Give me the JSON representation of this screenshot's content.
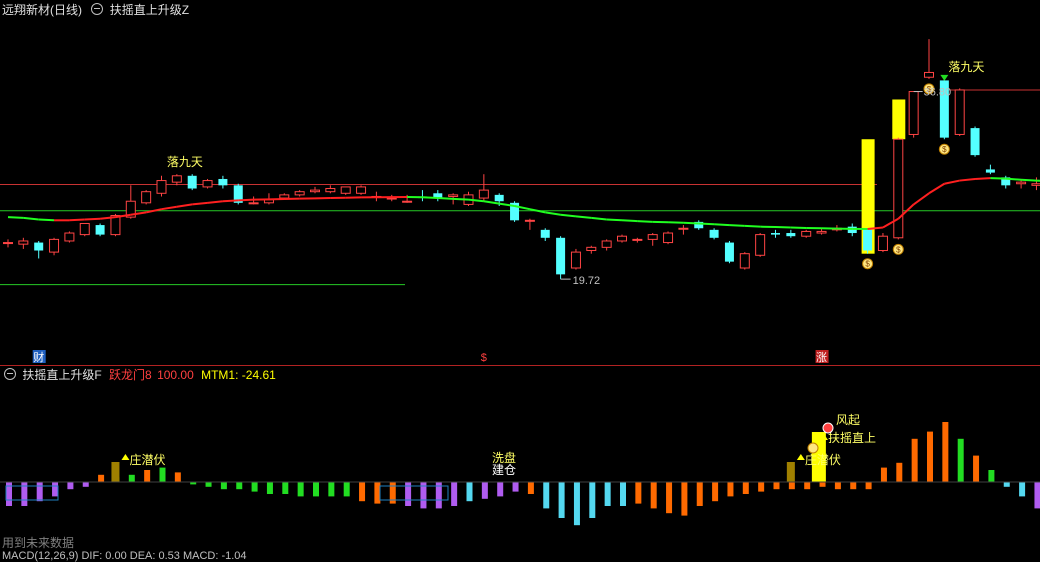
{
  "header": {
    "stock_title": "远翔新材(日线)",
    "indicator_title": "扶摇直上升级Z",
    "collapse_icon": "minus-icon"
  },
  "chart_data": [
    {
      "type": "candlestick",
      "title": "扶摇直上升级Z",
      "ylim": [
        18.5,
        38.0
      ],
      "annotations": {
        "high_label": "36.80",
        "low_label": "19.72",
        "signal_label": "落九天"
      },
      "bottom_markers": [
        "财",
        "$",
        "涨"
      ],
      "colors": {
        "up": "#ff4444",
        "down": "#54ffff",
        "ma_up": "#ff2020",
        "ma_down": "#20ff20",
        "signal": "#ffff00",
        "resist": "#c83232",
        "support": "#26c926"
      },
      "candles": [
        {
          "o": 24.0,
          "h": 24.2,
          "l": 23.7,
          "c": 24.0
        },
        {
          "o": 23.9,
          "h": 24.3,
          "l": 23.6,
          "c": 24.1
        },
        {
          "o": 24.0,
          "h": 24.1,
          "l": 23.0,
          "c": 23.5
        },
        {
          "o": 23.4,
          "h": 24.3,
          "l": 23.2,
          "c": 24.2
        },
        {
          "o": 24.1,
          "h": 24.7,
          "l": 24.0,
          "c": 24.6
        },
        {
          "o": 24.5,
          "h": 25.2,
          "l": 24.4,
          "c": 25.2
        },
        {
          "o": 25.1,
          "h": 25.2,
          "l": 24.4,
          "c": 24.5
        },
        {
          "o": 24.5,
          "h": 25.8,
          "l": 24.4,
          "c": 25.7
        },
        {
          "o": 25.6,
          "h": 27.6,
          "l": 25.5,
          "c": 26.6
        },
        {
          "o": 26.5,
          "h": 27.3,
          "l": 26.4,
          "c": 27.2
        },
        {
          "o": 27.1,
          "h": 28.2,
          "l": 26.9,
          "c": 27.9
        },
        {
          "o": 27.8,
          "h": 28.3,
          "l": 27.6,
          "c": 28.2
        },
        {
          "o": 28.2,
          "h": 28.3,
          "l": 27.3,
          "c": 27.4
        },
        {
          "o": 27.5,
          "h": 28.0,
          "l": 27.4,
          "c": 27.9
        },
        {
          "o": 28.0,
          "h": 28.2,
          "l": 27.4,
          "c": 27.6
        },
        {
          "o": 27.6,
          "h": 27.7,
          "l": 26.4,
          "c": 26.5
        },
        {
          "o": 26.5,
          "h": 26.9,
          "l": 26.4,
          "c": 26.5
        },
        {
          "o": 26.5,
          "h": 27.1,
          "l": 26.4,
          "c": 26.7
        },
        {
          "o": 26.8,
          "h": 27.1,
          "l": 26.7,
          "c": 27.0
        },
        {
          "o": 27.0,
          "h": 27.3,
          "l": 26.9,
          "c": 27.2
        },
        {
          "o": 27.2,
          "h": 27.5,
          "l": 27.1,
          "c": 27.3
        },
        {
          "o": 27.2,
          "h": 27.6,
          "l": 27.1,
          "c": 27.4
        },
        {
          "o": 27.1,
          "h": 27.5,
          "l": 27.0,
          "c": 27.5
        },
        {
          "o": 27.1,
          "h": 27.6,
          "l": 27.0,
          "c": 27.5
        },
        {
          "o": 26.9,
          "h": 27.2,
          "l": 26.6,
          "c": 26.9
        },
        {
          "o": 26.8,
          "h": 27.0,
          "l": 26.6,
          "c": 26.8
        },
        {
          "o": 26.6,
          "h": 27.0,
          "l": 26.5,
          "c": 26.6
        },
        {
          "o": 26.9,
          "h": 27.3,
          "l": 26.6,
          "c": 26.8
        },
        {
          "o": 27.1,
          "h": 27.3,
          "l": 26.6,
          "c": 26.8
        },
        {
          "o": 26.9,
          "h": 27.1,
          "l": 26.4,
          "c": 27.0
        },
        {
          "o": 26.4,
          "h": 27.2,
          "l": 26.3,
          "c": 27.0
        },
        {
          "o": 26.8,
          "h": 28.3,
          "l": 26.6,
          "c": 27.3
        },
        {
          "o": 27.0,
          "h": 27.1,
          "l": 26.3,
          "c": 26.6
        },
        {
          "o": 26.5,
          "h": 26.6,
          "l": 25.3,
          "c": 25.4
        },
        {
          "o": 25.4,
          "h": 25.5,
          "l": 24.8,
          "c": 25.4
        },
        {
          "o": 24.8,
          "h": 24.9,
          "l": 24.1,
          "c": 24.3
        },
        {
          "o": 24.3,
          "h": 24.4,
          "l": 21.7,
          "c": 22.0
        },
        {
          "o": 22.4,
          "h": 23.6,
          "l": 22.3,
          "c": 23.4
        },
        {
          "o": 23.5,
          "h": 23.8,
          "l": 23.3,
          "c": 23.7
        },
        {
          "o": 23.7,
          "h": 24.2,
          "l": 23.5,
          "c": 24.1
        },
        {
          "o": 24.1,
          "h": 24.5,
          "l": 24.0,
          "c": 24.4
        },
        {
          "o": 24.2,
          "h": 24.3,
          "l": 24.0,
          "c": 24.2
        },
        {
          "o": 24.2,
          "h": 24.6,
          "l": 23.8,
          "c": 24.5
        },
        {
          "o": 24.0,
          "h": 24.7,
          "l": 23.9,
          "c": 24.6
        },
        {
          "o": 24.9,
          "h": 25.1,
          "l": 24.5,
          "c": 24.9
        },
        {
          "o": 25.3,
          "h": 25.4,
          "l": 24.8,
          "c": 24.9
        },
        {
          "o": 24.8,
          "h": 24.9,
          "l": 24.2,
          "c": 24.3
        },
        {
          "o": 24.0,
          "h": 24.1,
          "l": 22.7,
          "c": 22.8
        },
        {
          "o": 22.4,
          "h": 23.4,
          "l": 22.3,
          "c": 23.3
        },
        {
          "o": 23.2,
          "h": 24.6,
          "l": 23.1,
          "c": 24.5
        },
        {
          "o": 24.6,
          "h": 24.8,
          "l": 24.3,
          "c": 24.5
        },
        {
          "o": 24.6,
          "h": 24.8,
          "l": 24.3,
          "c": 24.4
        },
        {
          "o": 24.4,
          "h": 24.8,
          "l": 24.3,
          "c": 24.7
        },
        {
          "o": 24.6,
          "h": 24.9,
          "l": 24.5,
          "c": 24.7
        },
        {
          "o": 24.8,
          "h": 25.1,
          "l": 24.7,
          "c": 24.9
        },
        {
          "o": 25.0,
          "h": 25.2,
          "l": 24.4,
          "c": 24.6
        },
        {
          "o": 24.8,
          "h": 24.9,
          "l": 23.3,
          "c": 23.5
        },
        {
          "o": 23.5,
          "h": 24.6,
          "l": 23.4,
          "c": 24.4
        },
        {
          "o": 24.3,
          "h": 30.6,
          "l": 24.2,
          "c": 30.5
        },
        {
          "o": 30.8,
          "h": 33.5,
          "l": 30.6,
          "c": 33.5
        },
        {
          "o": 34.4,
          "h": 36.8,
          "l": 34.3,
          "c": 34.7
        },
        {
          "o": 34.2,
          "h": 34.3,
          "l": 30.5,
          "c": 30.6
        },
        {
          "o": 30.8,
          "h": 33.7,
          "l": 30.7,
          "c": 33.6
        },
        {
          "o": 31.2,
          "h": 31.3,
          "l": 29.4,
          "c": 29.5
        },
        {
          "o": 28.6,
          "h": 28.9,
          "l": 28.3,
          "c": 28.4
        },
        {
          "o": 28.1,
          "h": 28.2,
          "l": 27.4,
          "c": 27.6
        },
        {
          "o": 27.7,
          "h": 28.0,
          "l": 27.4,
          "c": 27.8
        },
        {
          "o": 27.6,
          "h": 28.1,
          "l": 27.3,
          "c": 27.7
        },
        {
          "o": 27.8,
          "h": 28.0,
          "l": 27.0,
          "c": 27.1
        },
        {
          "o": 27.4,
          "h": 27.6,
          "l": 26.3,
          "c": 26.4
        },
        {
          "o": 26.3,
          "h": 26.4,
          "l": 25.5,
          "c": 25.7
        },
        {
          "o": 25.7,
          "h": 26.1,
          "l": 25.4,
          "c": 26.0
        },
        {
          "o": 26.0,
          "h": 26.2,
          "l": 25.6,
          "c": 26.0
        }
      ],
      "ma_line": [
        25.6,
        25.55,
        25.45,
        25.4,
        25.4,
        25.45,
        25.5,
        25.6,
        25.75,
        25.9,
        26.1,
        26.25,
        26.4,
        26.5,
        26.6,
        26.65,
        26.7,
        26.72,
        26.74,
        26.76,
        26.78,
        26.8,
        26.82,
        26.84,
        26.85,
        26.86,
        26.87,
        26.85,
        26.8,
        26.75,
        26.7,
        26.6,
        26.45,
        26.3,
        26.1,
        25.9,
        25.75,
        25.65,
        25.55,
        25.45,
        25.4,
        25.35,
        25.3,
        25.28,
        25.25,
        25.2,
        25.15,
        25.1,
        25.05,
        25.0,
        24.98,
        24.95,
        24.92,
        24.9,
        24.88,
        24.86,
        24.85,
        24.95,
        25.5,
        26.4,
        27.1,
        27.7,
        27.9,
        28.0,
        28.05,
        28.02,
        27.95,
        27.9,
        27.85,
        27.75,
        27.6,
        27.45,
        27.35,
        27.3
      ],
      "resist_line": 27.65,
      "resist_line_high": 33.6,
      "support_line": 26.0,
      "low_line": 22.3,
      "yellow_bars": [
        [
          56,
          30.5,
          23.3
        ],
        [
          58,
          33.0,
          30.5
        ]
      ],
      "money_bags": [
        56,
        58,
        60,
        61
      ],
      "signal_candles": [
        11,
        61
      ]
    },
    {
      "type": "bar",
      "title": "扶摇直上升级F",
      "legend": [
        {
          "label": "跃龙门8",
          "value": "100.00"
        },
        {
          "label": "MTM1:",
          "value": "-24.61"
        }
      ],
      "labels": {
        "accumulate": "庄潜伏",
        "wash": "洗盘",
        "build": "建仓",
        "wind": "风起",
        "soar": "扶摇直上",
        "accum2": "庄潜伏"
      },
      "values": [
        -10,
        -10,
        -8,
        -6,
        -3,
        -2,
        3,
        2,
        3,
        5,
        6,
        4,
        -1,
        -2,
        -3,
        -3,
        -4,
        -5,
        -5,
        -6,
        -6,
        -6,
        -6,
        -8,
        -9,
        -9,
        -10,
        -11,
        -11,
        -10,
        -8,
        -7,
        -6,
        -4,
        -5,
        -11,
        -15,
        -18,
        -15,
        -10,
        -10,
        -9,
        -11,
        -13,
        -14,
        -10,
        -8,
        -6,
        -5,
        -4,
        -3,
        -3,
        -3,
        -2,
        -3,
        -3,
        -3,
        6,
        8,
        18,
        21,
        25,
        18,
        11,
        5,
        -2,
        -6,
        -11,
        -14,
        -16,
        -17,
        -18,
        -19,
        -20
      ],
      "colors": {
        "pos": "#ff6a00",
        "neg_magenta": "#b05cf0",
        "neg_cyan": "#54d8f0",
        "neg_green": "#22dd22",
        "neg_orange": "#ff6a00",
        "pos_green": "#22dd22",
        "yellow": "#ffff00",
        "olive": "#a08000"
      },
      "bottom_text": "用到未来数据",
      "next_panel_text": "MACD(12,26,9) DIF: 0.00 DEA: 0.53 MACD: -1.04"
    }
  ]
}
